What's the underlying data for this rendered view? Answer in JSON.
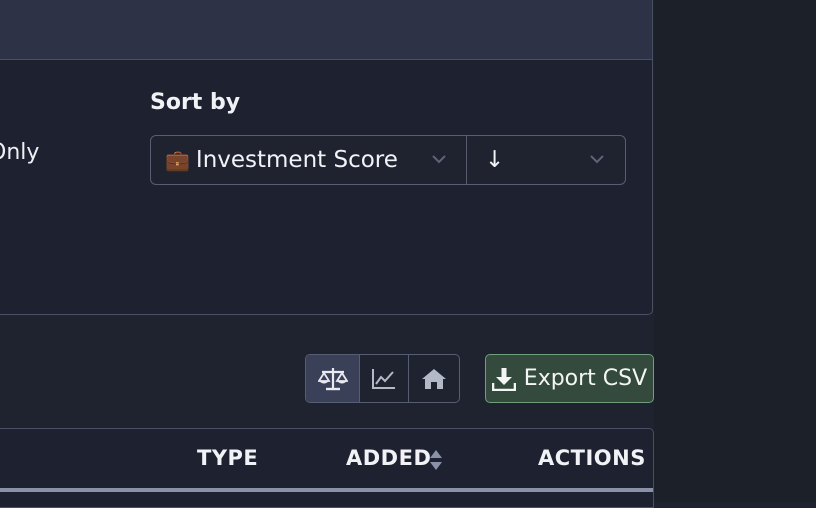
{
  "filters": {
    "only_label": "Only"
  },
  "sort": {
    "label": "Sort by",
    "field_icon": "💼",
    "field_value": "Investment Score",
    "direction_value": "↓"
  },
  "toolbar": {
    "views": [
      {
        "icon": "scale-icon",
        "active": true
      },
      {
        "icon": "line-chart-icon",
        "active": false
      },
      {
        "icon": "home-icon",
        "active": false
      }
    ],
    "export_label": "Export CSV"
  },
  "table": {
    "columns": [
      "TYPE",
      "ADDED",
      "ACTIONS"
    ]
  },
  "colors": {
    "background": "#1f2330",
    "export_button": "#334a3c",
    "export_border": "#6f9f7c"
  }
}
